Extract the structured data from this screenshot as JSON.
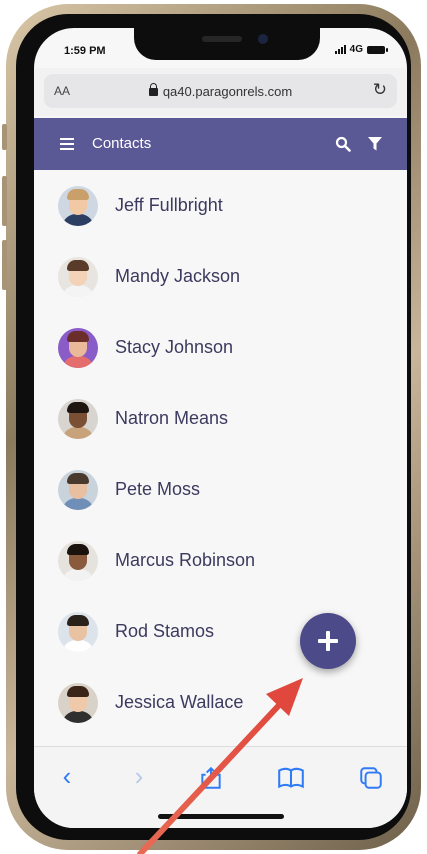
{
  "status_bar": {
    "time": "1:59 PM",
    "network": "4G"
  },
  "browser": {
    "text_size": "AA",
    "url": "qa40.paragonrels.com"
  },
  "header": {
    "title": "Contacts"
  },
  "contacts": [
    {
      "name": "Jeff Fullbright",
      "hair": "#c9a06a",
      "skin": "#f1c9a5",
      "shirt": "#2d3e63",
      "bg": "#cfd8e2"
    },
    {
      "name": "Mandy Jackson",
      "hair": "#5a3a28",
      "skin": "#f3d2b8",
      "shirt": "#f4f4f4",
      "bg": "#e8e4df"
    },
    {
      "name": "Stacy Johnson",
      "hair": "#6b2e2a",
      "skin": "#e9b99a",
      "shirt": "#e46d6d",
      "bg": "#8a5cc7"
    },
    {
      "name": "Natron Means",
      "hair": "#1e1410",
      "skin": "#7a4f33",
      "shirt": "#c8a27a",
      "bg": "#d8d4cf"
    },
    {
      "name": "Pete Moss",
      "hair": "#4a3a2e",
      "skin": "#e8bfa0",
      "shirt": "#6f8fb8",
      "bg": "#c9d3dc"
    },
    {
      "name": "Marcus Robinson",
      "hair": "#1a120c",
      "skin": "#8a5a3c",
      "shirt": "#f2f2f2",
      "bg": "#e6e3df"
    },
    {
      "name": "Rod Stamos",
      "hair": "#2b211b",
      "skin": "#e9c2a2",
      "shirt": "#ffffff",
      "bg": "#dde3ea"
    },
    {
      "name": "Jessica Wallace",
      "hair": "#3b2418",
      "skin": "#f0c9aa",
      "shirt": "#2f2f2f",
      "bg": "#d9d2c8"
    }
  ],
  "icons": {
    "menu": "hamburger-icon",
    "search": "search-icon",
    "filter": "filter-icon",
    "add": "plus-icon",
    "back": "chevron-left-icon",
    "forward": "chevron-right-icon",
    "share": "share-icon",
    "bookmarks": "book-icon",
    "tabs": "tabs-icon"
  },
  "colors": {
    "header": "#5b5896",
    "fab": "#4d4a8a",
    "arrow": "#e05a4a",
    "toolbar_accent": "#2f7bf6"
  }
}
